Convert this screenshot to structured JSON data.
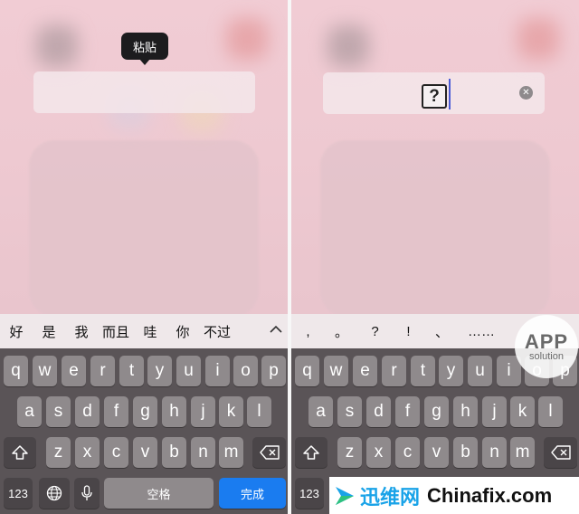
{
  "left": {
    "paste_menu_label": "粘贴",
    "candidates": [
      "好",
      "是",
      "我",
      "而且",
      "哇",
      "你",
      "不过"
    ],
    "expand_icon": "chevron-up-icon",
    "row1": [
      "q",
      "w",
      "e",
      "r",
      "t",
      "y",
      "u",
      "i",
      "o",
      "p"
    ],
    "row2": [
      "a",
      "s",
      "d",
      "f",
      "g",
      "h",
      "j",
      "k",
      "l"
    ],
    "row3": [
      "z",
      "x",
      "c",
      "v",
      "b",
      "n",
      "m"
    ],
    "key_123": "123",
    "space_label": "空格",
    "done_label": "完成"
  },
  "right": {
    "pasted_glyph": "?",
    "candidates": [
      ",",
      "。",
      "?",
      "!",
      "、",
      "……"
    ],
    "row1": [
      "q",
      "w",
      "e",
      "r",
      "t",
      "y",
      "u",
      "i",
      "o",
      "p"
    ],
    "row2": [
      "a",
      "s",
      "d",
      "f",
      "g",
      "h",
      "j",
      "k",
      "l"
    ],
    "row3": [
      "z",
      "x",
      "c",
      "v",
      "b",
      "n",
      "m"
    ],
    "key_123": "123"
  },
  "watermark": {
    "line1": "APP",
    "line2": "solution"
  },
  "banner": {
    "cn": "迅维网",
    "en": "Chinafix.com",
    "brand_color": "#1aa3e8"
  },
  "colors": {
    "done_key": "#1a7cf0",
    "key": "#8f8a8c",
    "dark_key": "#4a4548",
    "cursor": "#4a5bd6"
  }
}
